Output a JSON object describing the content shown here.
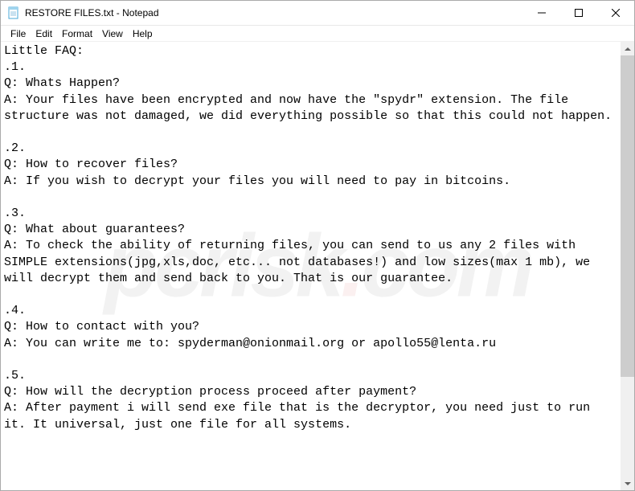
{
  "window": {
    "title": "RESTORE FILES.txt - Notepad"
  },
  "menu": {
    "file": "File",
    "edit": "Edit",
    "format": "Format",
    "view": "View",
    "help": "Help"
  },
  "content": {
    "text": "Little FAQ:\n.1.\nQ: Whats Happen?\nA: Your files have been encrypted and now have the \"spydr\" extension. The file structure was not damaged, we did everything possible so that this could not happen.\n\n.2.\nQ: How to recover files?\nA: If you wish to decrypt your files you will need to pay in bitcoins.\n\n.3.\nQ: What about guarantees?\nA: To check the ability of returning files, you can send to us any 2 files with SIMPLE extensions(jpg,xls,doc, etc... not databases!) and low sizes(max 1 mb), we will decrypt them and send back to you. That is our guarantee.\n\n.4.\nQ: How to contact with you?\nA: You can write me to: spyderman@onionmail.org or apollo55@lenta.ru\n\n.5.\nQ: How will the decryption process proceed after payment?\nA: After payment i will send exe file that is the decryptor, you need just to run it. It universal, just one file for all systems."
  },
  "watermark": {
    "prefix": "pcrisk",
    "dot": ".",
    "suffix": "com"
  }
}
